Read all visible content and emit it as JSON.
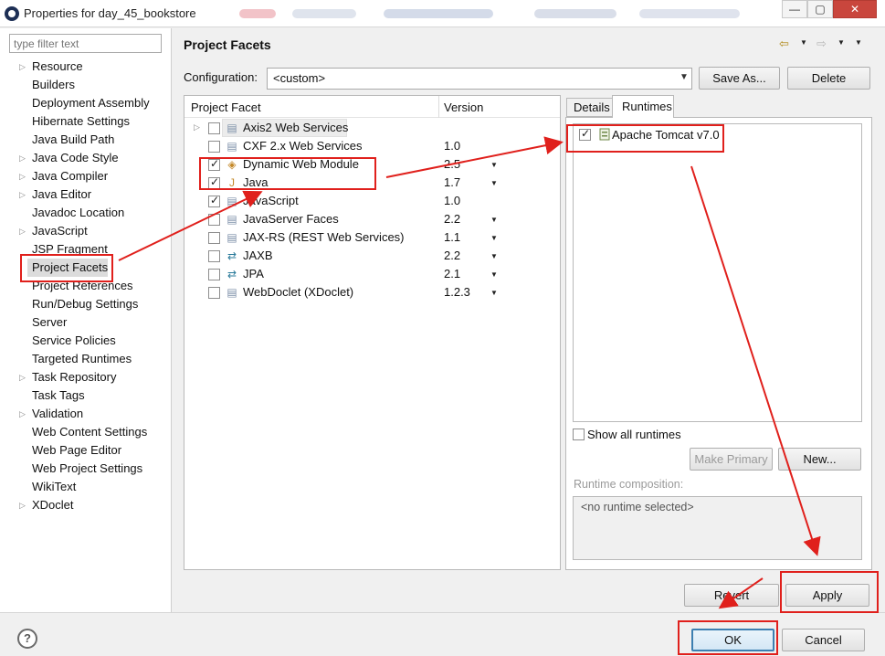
{
  "window": {
    "title": "Properties for day_45_bookstore",
    "minimize": "—",
    "restore": "▢",
    "close": "✕"
  },
  "nav": {
    "filter_placeholder": "type filter text",
    "items": [
      {
        "label": "Resource",
        "expandable": true
      },
      {
        "label": "Builders",
        "expandable": false
      },
      {
        "label": "Deployment Assembly",
        "expandable": false
      },
      {
        "label": "Hibernate Settings",
        "expandable": false
      },
      {
        "label": "Java Build Path",
        "expandable": false
      },
      {
        "label": "Java Code Style",
        "expandable": true
      },
      {
        "label": "Java Compiler",
        "expandable": true
      },
      {
        "label": "Java Editor",
        "expandable": true
      },
      {
        "label": "Javadoc Location",
        "expandable": false
      },
      {
        "label": "JavaScript",
        "expandable": true
      },
      {
        "label": "JSP Fragment",
        "expandable": false
      },
      {
        "label": "Project Facets",
        "expandable": false,
        "selected": true
      },
      {
        "label": "Project References",
        "expandable": false
      },
      {
        "label": "Run/Debug Settings",
        "expandable": false
      },
      {
        "label": "Server",
        "expandable": false
      },
      {
        "label": "Service Policies",
        "expandable": false
      },
      {
        "label": "Targeted Runtimes",
        "expandable": false
      },
      {
        "label": "Task Repository",
        "expandable": true
      },
      {
        "label": "Task Tags",
        "expandable": false
      },
      {
        "label": "Validation",
        "expandable": true
      },
      {
        "label": "Web Content Settings",
        "expandable": false
      },
      {
        "label": "Web Page Editor",
        "expandable": false
      },
      {
        "label": "Web Project Settings",
        "expandable": false
      },
      {
        "label": "WikiText",
        "expandable": false
      },
      {
        "label": "XDoclet",
        "expandable": true
      }
    ]
  },
  "main": {
    "title": "Project Facets",
    "config_label": "Configuration:",
    "config_value": "<custom>",
    "save_as_label": "Save As...",
    "delete_label": "Delete"
  },
  "facets": {
    "col_facet": "Project Facet",
    "col_version": "Version",
    "rows": [
      {
        "name": "Axis2 Web Services",
        "version": "",
        "checked": false,
        "expandable": true,
        "dropdown": false,
        "icon": "page-icon"
      },
      {
        "name": "CXF 2.x Web Services",
        "version": "1.0",
        "checked": false,
        "expandable": false,
        "dropdown": false,
        "icon": "page-icon"
      },
      {
        "name": "Dynamic Web Module",
        "version": "2.5",
        "checked": true,
        "expandable": false,
        "dropdown": true,
        "icon": "web-module-icon"
      },
      {
        "name": "Java",
        "version": "1.7",
        "checked": true,
        "expandable": false,
        "dropdown": true,
        "icon": "java-icon"
      },
      {
        "name": "JavaScript",
        "version": "1.0",
        "checked": true,
        "expandable": false,
        "dropdown": false,
        "icon": "page-icon"
      },
      {
        "name": "JavaServer Faces",
        "version": "2.2",
        "checked": false,
        "expandable": false,
        "dropdown": true,
        "icon": "page-icon"
      },
      {
        "name": "JAX-RS (REST Web Services)",
        "version": "1.1",
        "checked": false,
        "expandable": false,
        "dropdown": true,
        "icon": "page-icon"
      },
      {
        "name": "JAXB",
        "version": "2.2",
        "checked": false,
        "expandable": false,
        "dropdown": true,
        "icon": "arrows-icon"
      },
      {
        "name": "JPA",
        "version": "2.1",
        "checked": false,
        "expandable": false,
        "dropdown": true,
        "icon": "arrows-icon"
      },
      {
        "name": "WebDoclet (XDoclet)",
        "version": "1.2.3",
        "checked": false,
        "expandable": false,
        "dropdown": true,
        "icon": "page-icon"
      }
    ]
  },
  "runtimes": {
    "tab_details": "Details",
    "tab_runtimes": "Runtimes",
    "items": [
      {
        "name": "Apache Tomcat v7.0",
        "checked": true
      }
    ],
    "show_all_label": "Show all runtimes",
    "make_primary_label": "Make Primary",
    "new_label": "New...",
    "composition_label": "Runtime composition:",
    "composition_value": "<no runtime selected>"
  },
  "footer": {
    "revert_label": "Revert",
    "apply_label": "Apply",
    "ok_label": "OK",
    "cancel_label": "Cancel",
    "help_label": "?"
  },
  "colors": {
    "annotation": "#e0201c",
    "selection": "#dcdcdc",
    "ok_border": "#3c7fb1"
  }
}
